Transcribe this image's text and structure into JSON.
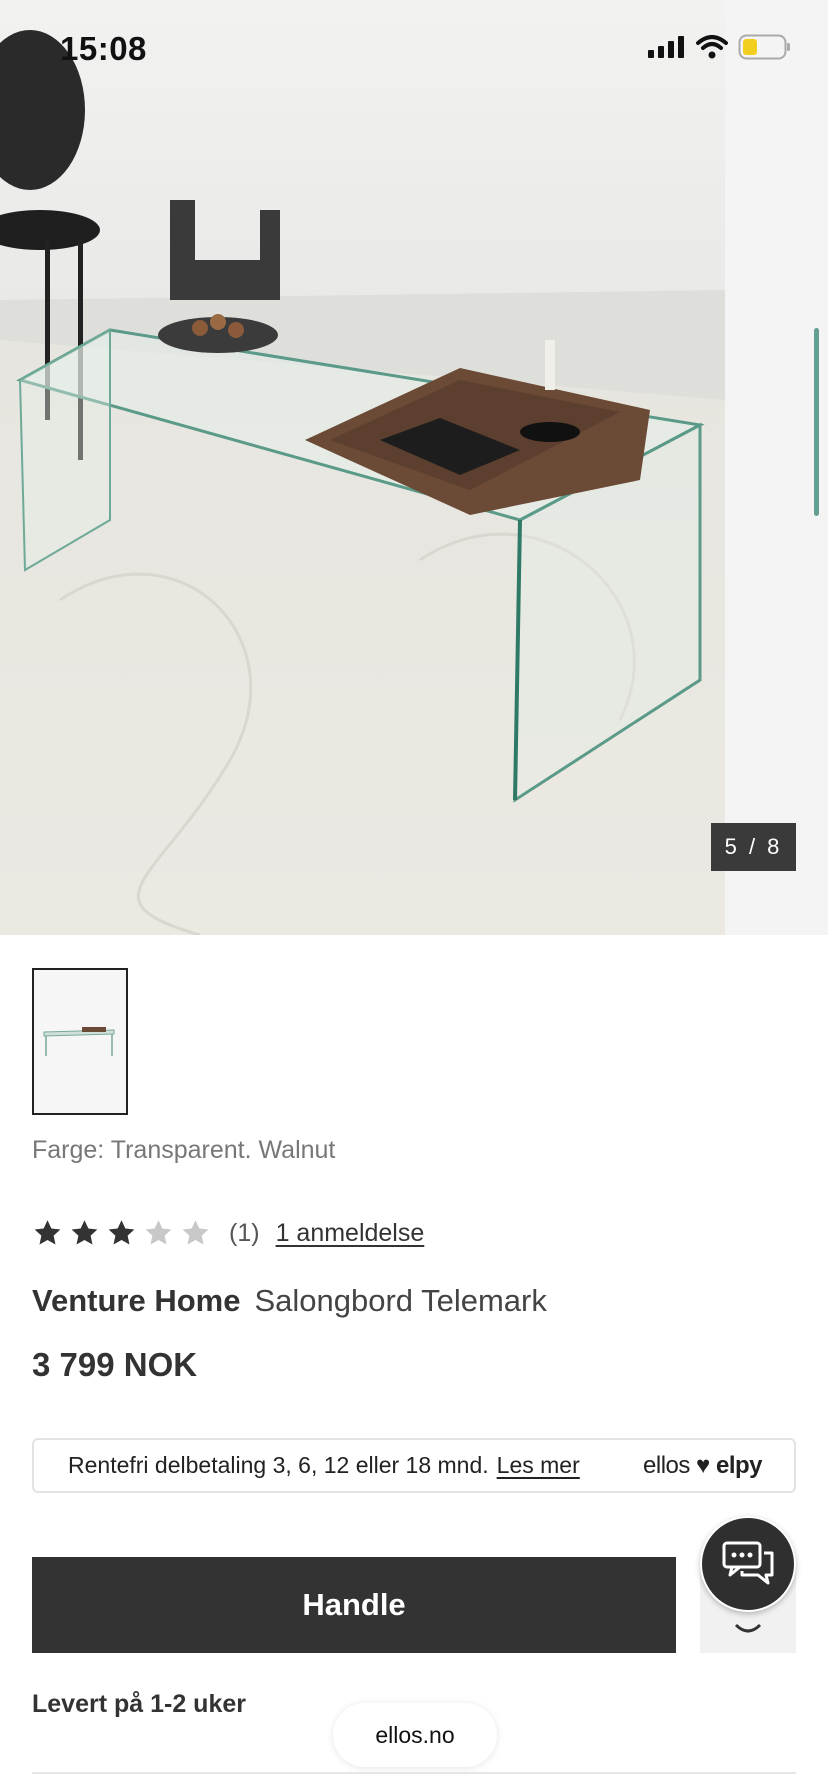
{
  "status_bar": {
    "time": "15:08"
  },
  "gallery": {
    "counter": "5 / 8",
    "thumbnail_alt": "Salongbord Telemark thumbnail"
  },
  "product": {
    "color_label": "Farge: Transparent. Walnut",
    "rating": {
      "value": 3,
      "max": 5,
      "count_text": "(1)",
      "reviews_link": "1 anmeldelse"
    },
    "brand": "Venture Home",
    "name": "Salongbord Telemark",
    "price": "3 799 NOK"
  },
  "financing": {
    "text": "Rentefri delbetaling 3, 6, 12 eller 18 mnd.",
    "link": "Les mer",
    "logo_left": "ellos",
    "logo_right": "elpy"
  },
  "actions": {
    "buy_label": "Handle",
    "wishlist_icon": "heart-icon",
    "chat_icon": "chat-bubbles-icon"
  },
  "delivery": "Levert på 1-2 uker",
  "browser": {
    "domain": "ellos.no"
  },
  "colors": {
    "button": "#333333",
    "counter_bg": "#3a3a3a",
    "star_filled": "#333333",
    "star_empty": "#c8c8c8"
  }
}
